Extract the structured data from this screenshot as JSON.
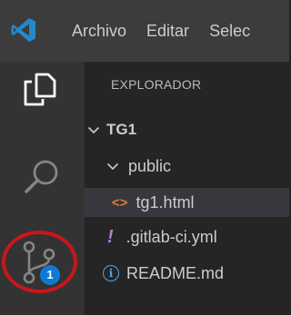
{
  "titlebar": {
    "logo_icon": "vscode-logo-icon",
    "menu": [
      "Archivo",
      "Editar",
      "Selec"
    ]
  },
  "activity_bar": {
    "items": [
      {
        "name": "explorer",
        "icon": "files-icon"
      },
      {
        "name": "search",
        "icon": "search-icon"
      },
      {
        "name": "source-control",
        "icon": "source-control-icon",
        "badge": "1"
      }
    ],
    "highlight_color": "#c8171c"
  },
  "explorer": {
    "title": "EXPLORADOR",
    "tree": {
      "root": "TG1",
      "folder": "public",
      "selected_file": "tg1.html",
      "files": [
        ".gitlab-ci.yml",
        "README.md"
      ]
    }
  },
  "colors": {
    "titlebar": "#3c3c3c",
    "activity_bar": "#333333",
    "sidebar": "#252526",
    "selected_row": "#37373d",
    "badge": "#0e7ad4",
    "html_icon": "#e37933",
    "yml_icon": "#b180d7",
    "info_icon": "#4aa6e6"
  }
}
